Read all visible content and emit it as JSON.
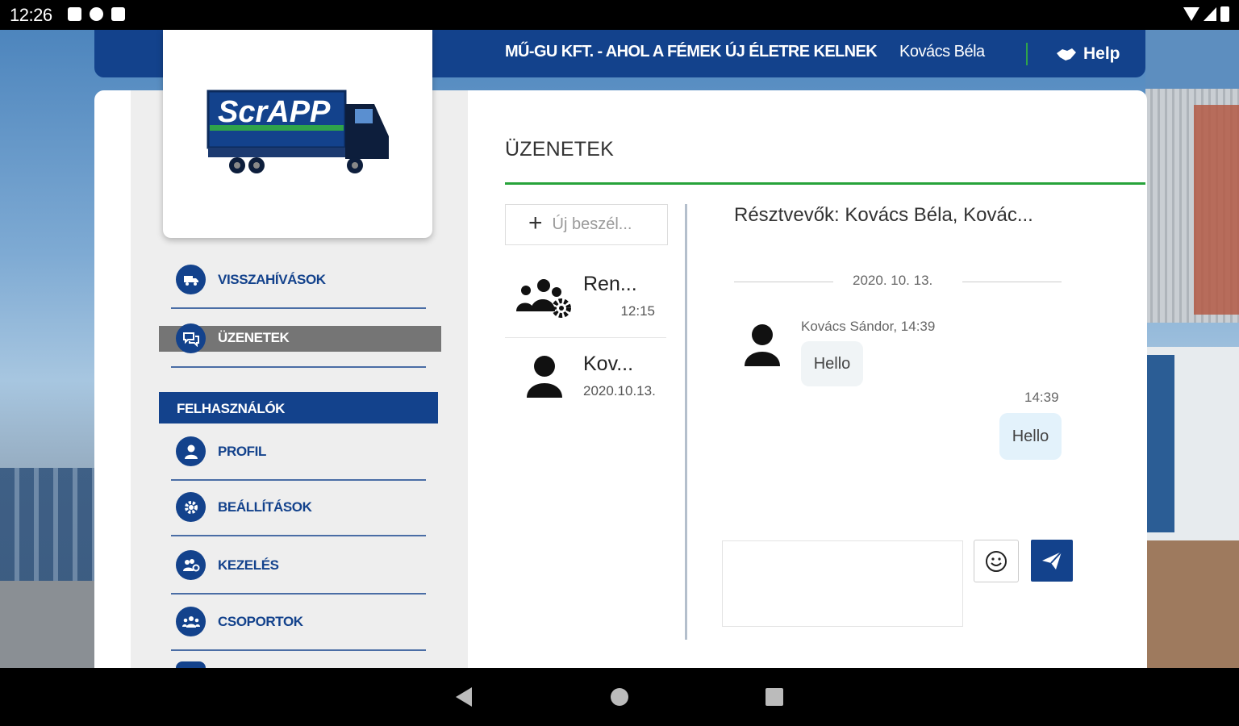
{
  "status_bar": {
    "time": "12:26"
  },
  "header": {
    "company": "MŰ-GU KFT. - AHOL A FÉMEK ÚJ ÉLETRE KELNEK",
    "user": "Kovács Béla",
    "help_label": "Help"
  },
  "logo": {
    "text": "ScrAPP"
  },
  "sidebar": {
    "items": [
      {
        "label": "VISSZAHÍVÁSOK",
        "icon": "truck-icon"
      },
      {
        "label": "ÜZENETEK",
        "icon": "chat-icon",
        "active": true
      }
    ],
    "section_header": "FELHASZNÁLÓK",
    "user_items": [
      {
        "label": "PROFIL",
        "icon": "person-icon"
      },
      {
        "label": "BEÁLLÍTÁSOK",
        "icon": "gear-icon"
      },
      {
        "label": "KEZELÉS",
        "icon": "users-gear-icon"
      },
      {
        "label": "CSOPORTOK",
        "icon": "group-icon"
      }
    ]
  },
  "messages": {
    "title": "ÜZENETEK",
    "new_conversation_label": "Új beszél...",
    "conversations": [
      {
        "name": "Ren...",
        "time": "12:15",
        "icon": "users-gear-icon"
      },
      {
        "name": "Kov...",
        "date": "2020.10.13.",
        "icon": "person-icon"
      }
    ],
    "participants": "Résztvevők: Kovács Béla, Kovác...",
    "date_separator": "2020. 10. 13.",
    "incoming": {
      "sender": "Kovács Sándor, 14:39",
      "text": "Hello"
    },
    "outgoing": {
      "time": "14:39",
      "text": "Hello"
    }
  },
  "colors": {
    "primary": "#13428c",
    "accent_green": "#27a33a",
    "active_gray": "#757575"
  }
}
